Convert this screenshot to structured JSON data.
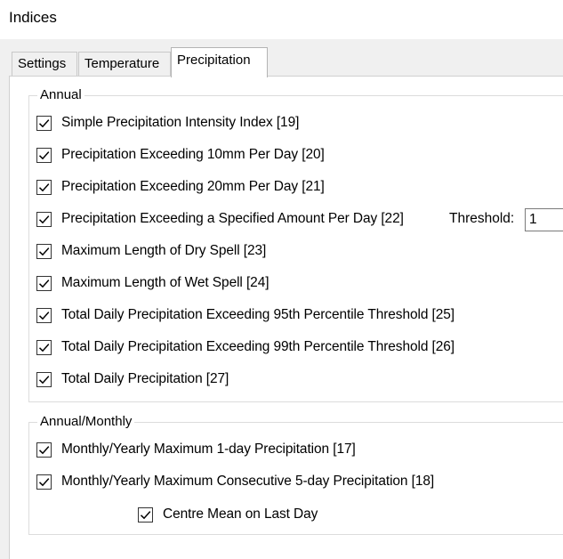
{
  "window": {
    "title": "Indices"
  },
  "tabs": [
    {
      "label": "Settings",
      "active": false
    },
    {
      "label": "Temperature",
      "active": false
    },
    {
      "label": "Precipitation",
      "active": true
    }
  ],
  "annual": {
    "legend": "Annual",
    "items": [
      {
        "label": "Simple Precipitation Intensity Index [19]",
        "checked": true
      },
      {
        "label": "Precipitation Exceeding 10mm Per Day [20]",
        "checked": true
      },
      {
        "label": "Precipitation Exceeding 20mm Per Day [21]",
        "checked": true
      },
      {
        "label": "Precipitation Exceeding a Specified Amount Per Day [22]",
        "checked": true
      },
      {
        "label": "Maximum Length of Dry Spell [23]",
        "checked": true
      },
      {
        "label": "Maximum Length of Wet Spell [24]",
        "checked": true
      },
      {
        "label": "Total Daily Precipitation Exceeding 95th Percentile Threshold [25]",
        "checked": true
      },
      {
        "label": "Total Daily Precipitation Exceeding 99th Percentile Threshold [26]",
        "checked": true
      },
      {
        "label": "Total Daily Precipitation [27]",
        "checked": true
      }
    ],
    "threshold": {
      "label": "Threshold:",
      "value": "1"
    }
  },
  "annual_monthly": {
    "legend": "Annual/Monthly",
    "items": [
      {
        "label": "Monthly/Yearly Maximum 1-day Precipitation [17]",
        "checked": true
      },
      {
        "label": "Monthly/Yearly Maximum Consecutive 5-day Precipitation [18]",
        "checked": true
      }
    ],
    "centre_mean": {
      "label": "Centre Mean on Last Day",
      "checked": true
    }
  },
  "icons": {
    "checkbox": "checkmark-icon"
  },
  "colors": {
    "check": "#000000",
    "page_bg": "#ffffff",
    "window_bg": "#f0f0f0"
  }
}
